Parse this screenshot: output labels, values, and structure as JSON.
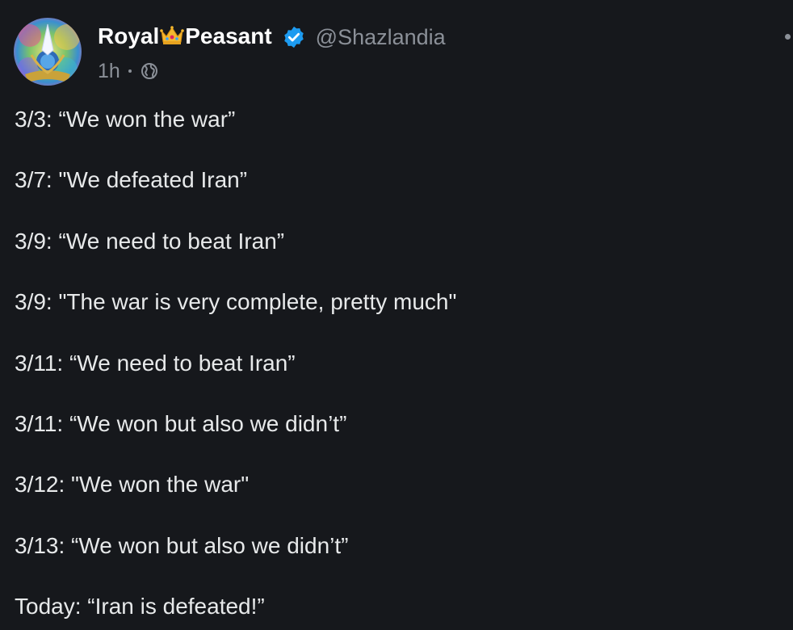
{
  "post": {
    "display_name_left": "Royal",
    "display_name_right": "Peasant",
    "handle": "@Shazlandia",
    "time": "1h",
    "visibility_icon": "globe-icon",
    "crown_icon": "crown-emoji",
    "verified_icon": "verified-badge-icon",
    "lines": [
      "3/3: “We won the war”",
      "3/7: \"We defeated Iran”",
      "3/9: “We need to beat Iran”",
      "3/9: \"The war is very complete, pretty much\"",
      "3/11: “We need to beat Iran”",
      "3/11: “We won but also we didn’t”",
      "3/12: \"We won the war\"",
      "3/13: “We won but also we didn’t”",
      "Today: “Iran is defeated!”"
    ]
  },
  "colors": {
    "background": "#16181c",
    "text": "#e7e9ea",
    "muted": "#8b9098",
    "verified_blue": "#1d9bf0"
  }
}
